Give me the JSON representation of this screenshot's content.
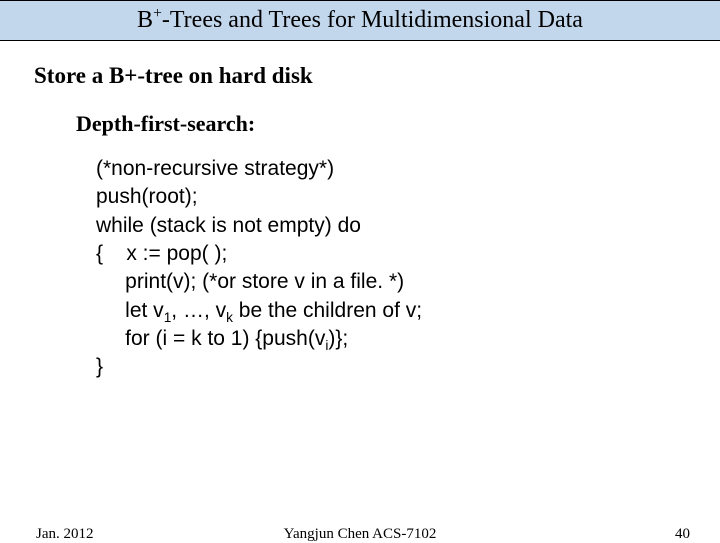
{
  "title": {
    "pre": "B",
    "sup": "+",
    "post": "-Trees and Trees for Multidimensional Data"
  },
  "section": "Store a B+-tree on hard disk",
  "subsection": "Depth-first-search:",
  "code": {
    "l1": "(*non-recursive strategy*)",
    "l2": "push(root);",
    "l3": "while (stack is not empty) do",
    "l4": "{    x := pop( );",
    "l5a": "     print(v); (*or store v in a file.",
    "l5b": "*)",
    "l6a": "     let v",
    "l6b": ", …, v",
    "l6c": " be the children of v;",
    "l7a": "     for (i = k to 1) {push(v",
    "l7b": ")};",
    "l8": "}",
    "sub1": "1",
    "subk": "k",
    "subi": "i"
  },
  "footer": {
    "date": "Jan. 2012",
    "center": "Yangjun Chen        ACS-7102",
    "page": "40"
  }
}
